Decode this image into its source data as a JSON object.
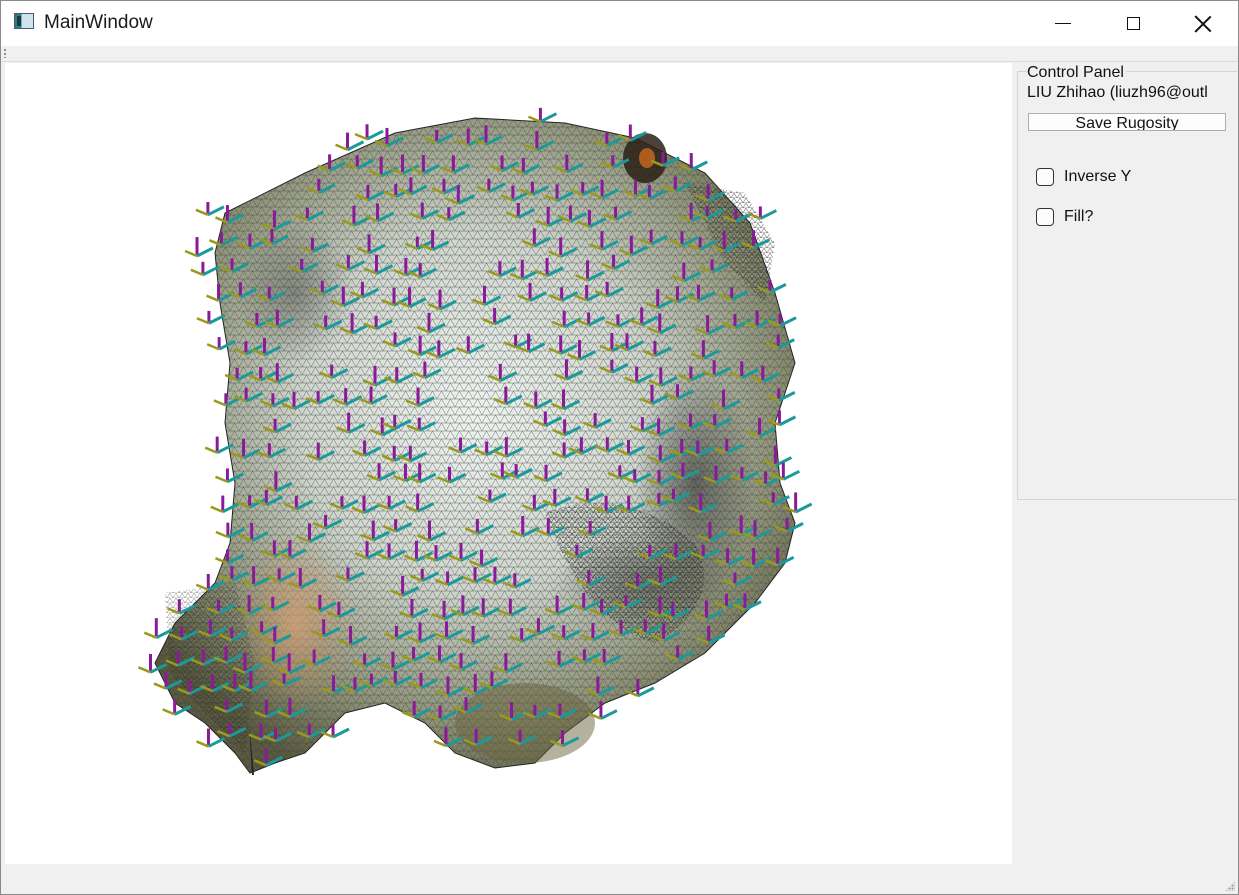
{
  "window": {
    "title": "MainWindow",
    "icon": "qt-app-icon",
    "controls": [
      "minimize-icon",
      "maximize-icon",
      "close-icon"
    ]
  },
  "control_panel": {
    "title": "Control Panel",
    "author": "LIU Zhihao (liuzh96@outl",
    "save_button_label": "Save Rugosity",
    "checkboxes": [
      {
        "label": "Inverse Y",
        "checked": false
      },
      {
        "label": "Fill?",
        "checked": false
      }
    ]
  },
  "viewport": {
    "content": "3d-wireframe-mesh-with-axes",
    "colors": {
      "background": "#ffffff",
      "axis_vertical": "#8b1a9a",
      "axis_teal": "#1a9a9a",
      "axis_olive": "#9a9a1a"
    }
  }
}
